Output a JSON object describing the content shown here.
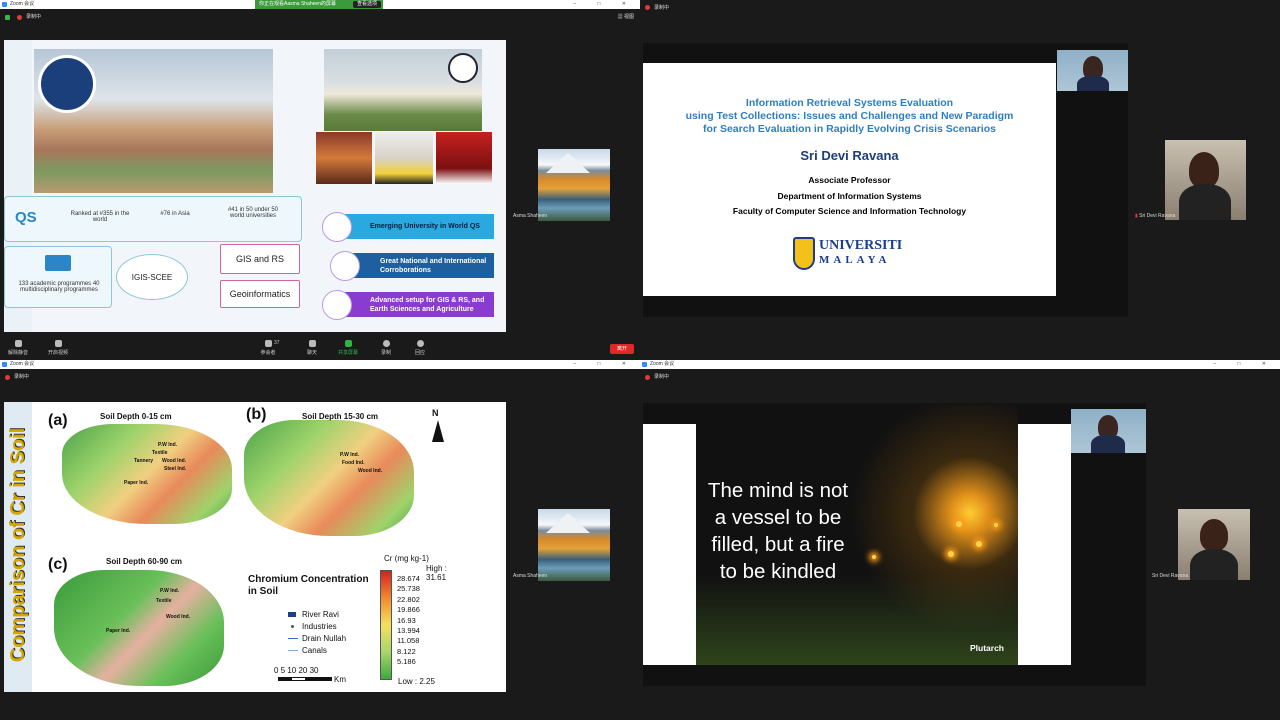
{
  "app": {
    "title": "Zoom 会议"
  },
  "q1": {
    "recording": "录制中",
    "banner": "你正在观看Aasma Shaheen的屏幕",
    "view_options": "查看选项",
    "view": "视图",
    "participant_name": "Asma Shaheen",
    "slide": {
      "qs_logo": "QS",
      "ranking1": "Ranked at #355 in the world",
      "ranking2": "#76 in Asia",
      "ranking3": "#41 in 50 under 50 world universities",
      "programmes": "133 academic programmes 40 multidisciplinary programmes",
      "center": "IGIS-SCEE",
      "box1": "GIS and RS",
      "box2": "Geoinformatics",
      "pill1": "Emerging University in World QS",
      "pill2": "Great National and International Corroborations",
      "pill3": "Advanced setup for GIS & RS, and Earth Sciences and Agriculture"
    },
    "toolbar": {
      "mute": "解除静音",
      "video": "开启视频",
      "participants": "参会者",
      "participants_count": "37",
      "chat": "聊天",
      "share": "共享屏幕",
      "record": "录制",
      "reactions": "回应",
      "leave": "离开"
    }
  },
  "q2": {
    "recording": "录制中",
    "slide": {
      "title_line1": "Information Retrieval Systems Evaluation",
      "title_line2": "using Test Collections: Issues and Challenges and New Paradigm",
      "title_line3": "for Search Evaluation in Rapidly Evolving Crisis Scenarios",
      "speaker": "Sri Devi Ravana",
      "role": "Associate Professor",
      "department": "Department of Information Systems",
      "faculty": "Faculty of Computer Science and Information Technology",
      "logo_line1": "UNIVERSITI",
      "logo_line2": "MALAYA"
    },
    "participant_name": "Sri Devi Ravana"
  },
  "q3": {
    "recording": "录制中",
    "participant_name": "Asma Shaheen",
    "slide": {
      "vertical_title": "Comparison of Cr in Soil",
      "panel_a": "(a)",
      "panel_b": "(b)",
      "panel_c": "(c)",
      "depth_a": "Soil Depth 0-15 cm",
      "depth_b": "Soil Depth 15-30 cm",
      "depth_c": "Soil Depth 60-90 cm",
      "north": "N",
      "legend_title": "Chromium Concentration in Soil",
      "legend_items": [
        "River Ravi",
        "Industries",
        "Drain Nullah",
        "Canals"
      ],
      "unit": "Cr (mg kg-1)",
      "high": "High : 31.61",
      "ticks": [
        "28.674",
        "25.738",
        "22.802",
        "19.866",
        "16.93",
        "13.994",
        "11.058",
        "8.122",
        "5.186"
      ],
      "low": "Low : 2.25",
      "scale": "0 5 10   20   30",
      "scale_unit": "Km",
      "places": [
        "P.W Ind.",
        "Textile",
        "Food Ind.",
        "Wood Ind.",
        "Tannery",
        "Steel Ind.",
        "Paper Ind."
      ]
    }
  },
  "q4": {
    "recording": "录制中",
    "quote": "The mind is not a vessel to be filled, but a fire to be kindled",
    "author": "Plutarch",
    "participant_name": "Sri Devi Ravana"
  }
}
